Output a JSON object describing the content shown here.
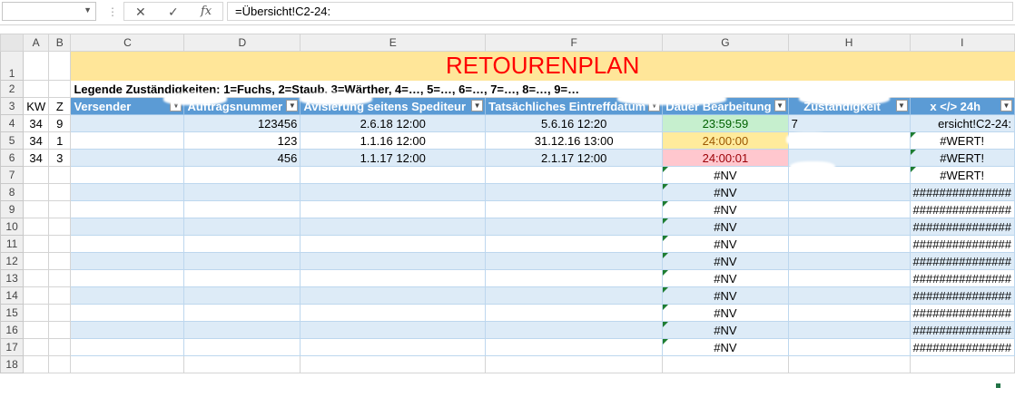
{
  "formula_bar": {
    "name_box": "",
    "formula": "=Übersicht!C2-24:"
  },
  "columns": [
    "A",
    "B",
    "C",
    "D",
    "E",
    "F",
    "G",
    "H",
    "I"
  ],
  "rows": [
    "1",
    "2",
    "3",
    "4",
    "5",
    "6",
    "7",
    "8",
    "9",
    "10",
    "11",
    "12",
    "13",
    "14",
    "15",
    "16",
    "17",
    "18"
  ],
  "title": "RETOURENPLAN",
  "legend": "Legende Zuständigkeiten: 1=Fuchs, 2=Staub, 3=Wärther, 4=…, 5=…, 6=…, 7=…, 8=…, 9=…",
  "header": {
    "kw": "KW",
    "z": "Z",
    "versender": "Versender",
    "auftragsnummer": "Auftragsnummer",
    "avisierung": "Avisierung seitens Spediteur",
    "eintreff": "Tatsächliches Eintreffdatum",
    "dauer": "Dauer Bearbeitung",
    "zustaendig": "Zuständigkeit",
    "x24": "x </> 24h"
  },
  "data_rows": [
    {
      "kw": "34",
      "z": "9",
      "versender": "",
      "auftrag": "123456",
      "avis": "2.6.18 12:00",
      "eintreff": "5.6.16 12:20",
      "dauer": "23:59:59",
      "zust": "7",
      "x24": "ersicht!C2-24:"
    },
    {
      "kw": "34",
      "z": "1",
      "versender": "",
      "auftrag": "123",
      "avis": "1.1.16 12:00",
      "eintreff": "31.12.16 13:00",
      "dauer": "24:00:00",
      "zust": "",
      "x24": "#WERT!"
    },
    {
      "kw": "34",
      "z": "3",
      "versender": "",
      "auftrag": "456",
      "avis": "1.1.17 12:00",
      "eintreff": "2.1.17 12:00",
      "dauer": "24:00:01",
      "zust": "",
      "x24": "#WERT!"
    }
  ],
  "empty_rows": [
    {
      "dauer": "#NV",
      "x24": "#WERT!"
    },
    {
      "dauer": "#NV",
      "x24": "###############"
    },
    {
      "dauer": "#NV",
      "x24": "###############"
    },
    {
      "dauer": "#NV",
      "x24": "###############"
    },
    {
      "dauer": "#NV",
      "x24": "###############"
    },
    {
      "dauer": "#NV",
      "x24": "###############"
    },
    {
      "dauer": "#NV",
      "x24": "###############"
    },
    {
      "dauer": "#NV",
      "x24": "###############"
    },
    {
      "dauer": "#NV",
      "x24": "###############"
    },
    {
      "dauer": "#NV",
      "x24": "###############"
    },
    {
      "dauer": "#NV",
      "x24": "###############"
    }
  ],
  "colors": {
    "title_fill": "#ffe699",
    "title_text": "#ff0000",
    "header_fill": "#5b9bd5",
    "band_fill": "#ddebf7",
    "green_fill": "#c6efce",
    "yellow_fill": "#ffeb9c",
    "red_fill": "#ffc7ce"
  },
  "icons": {
    "cancel": "close-icon",
    "enter": "check-icon",
    "function": "fx-icon",
    "filter": "filter-dropdown-icon"
  }
}
